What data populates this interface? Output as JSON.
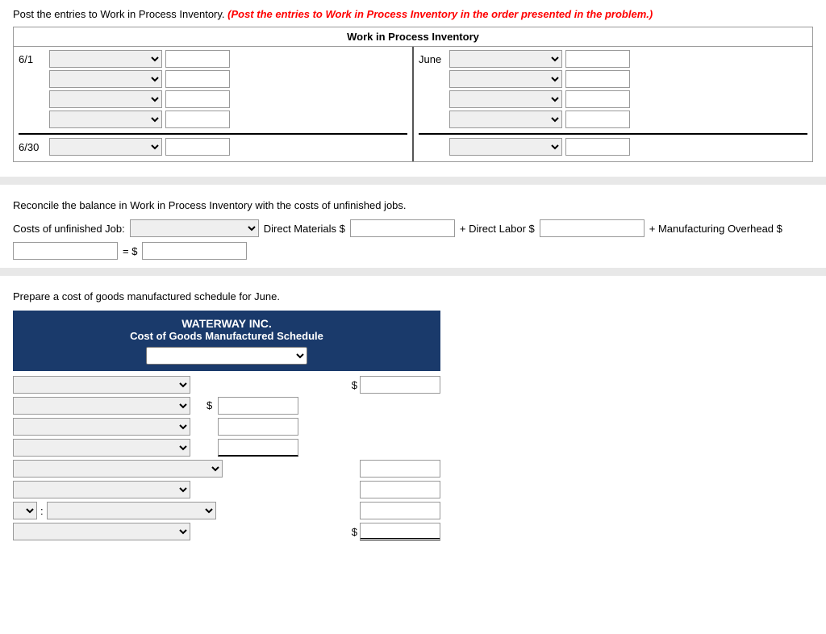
{
  "instructions": {
    "line1_static": "Post the entries to Work in Process Inventory. ",
    "line1_red": "(Post the entries to Work in Process Inventory in the order presented in the problem.)",
    "wip_title": "Work in Process Inventory",
    "date_61": "6/1",
    "date_630": "6/30",
    "date_june": "June",
    "reconcile_title": "Reconcile the balance in Work in Process Inventory with the costs of unfinished jobs.",
    "reconcile_label1": "Costs of unfinished Job:",
    "reconcile_label2": "Direct Materials $",
    "reconcile_label3": "+ Direct Labor $",
    "reconcile_label4": "+ Manufacturing Overhead $",
    "reconcile_label5": "= $",
    "schedule_intro": "Prepare a cost of goods manufactured schedule for June.",
    "schedule_title1": "WATERWAY INC.",
    "schedule_title2": "Cost of Goods Manufactured Schedule",
    "dollar": "$"
  }
}
